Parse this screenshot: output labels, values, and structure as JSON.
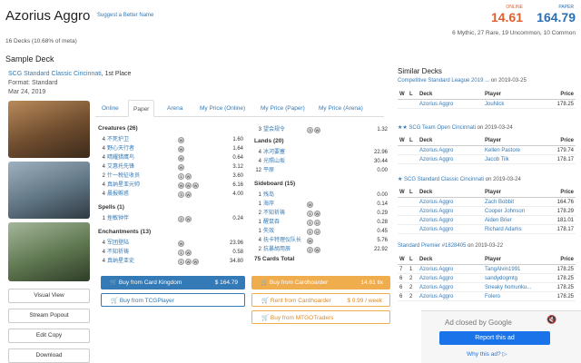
{
  "header": {
    "title": "Azorius Aggro",
    "suggest_link": "Suggest a Better Name",
    "online_label": "ONLINE",
    "online_price": "14.61",
    "paper_label": "PAPER",
    "paper_price": "164.79",
    "rarity": "6 Mythic, 27 Rare, 19 Uncommon, 10 Common",
    "decks_count": "16 Decks (10.68% of meta)"
  },
  "sample": {
    "heading": "Sample Deck",
    "event_link": "SCG Standard Classic Cincinnati",
    "event_place": ", 1st Place",
    "format": "Format: Standard",
    "date": "Mar 24, 2019"
  },
  "sidebar_buttons": [
    "Visual View",
    "Stream Popout",
    "Edit Copy",
    "Download"
  ],
  "tabs": [
    "Online",
    "Paper",
    "Arena",
    "My Price (Online)",
    "My Price (Paper)",
    "My Price (Arena)"
  ],
  "active_tab": "Paper",
  "creatures": {
    "heading": "Creatures (26)",
    "rows": [
      {
        "q": "4",
        "name": "不死护卫",
        "mana": [
          "W"
        ],
        "price": "1.60"
      },
      {
        "q": "4",
        "name": "野心天行者",
        "mana": [
          "W"
        ],
        "price": "1.64"
      },
      {
        "q": "4",
        "name": "晴耀猎鹰鸟",
        "mana": [
          "W"
        ],
        "price": "0.64"
      },
      {
        "q": "4",
        "name": "艾惠托先锋",
        "mana": [
          "W"
        ],
        "price": "3.12"
      },
      {
        "q": "2",
        "name": "什一税征收员",
        "mana": [
          "1",
          "W"
        ],
        "price": "3.60"
      },
      {
        "q": "4",
        "name": "真纳星亚元帅",
        "mana": [
          "W",
          "W",
          "W"
        ],
        "price": "6.16"
      },
      {
        "q": "4",
        "name": "晨报孵惑",
        "mana": [
          "3",
          "W"
        ],
        "price": "4.00"
      }
    ]
  },
  "spells": {
    "heading": "Spells (1)",
    "rows": [
      {
        "q": "1",
        "name": "挫敏钟伴",
        "mana": [
          "2",
          "W"
        ],
        "price": "0.24"
      }
    ]
  },
  "enchantments": {
    "heading": "Enchantments (13)",
    "rows": [
      {
        "q": "4",
        "name": "军团登陆",
        "mana": [
          "W"
        ],
        "price": "23.96"
      },
      {
        "q": "4",
        "name": "不知祈祷",
        "mana": [
          "1",
          "W"
        ],
        "price": "0.58"
      },
      {
        "q": "4",
        "name": "真纳星亚史",
        "mana": [
          "1",
          "W",
          "W"
        ],
        "price": "34.80"
      }
    ]
  },
  "col2_top": {
    "q": "3",
    "name": "望会规令",
    "mana": [
      "3",
      "W"
    ],
    "price": "1.32"
  },
  "lands": {
    "heading": "Lands (20)",
    "rows": [
      {
        "q": "4",
        "name": "冰河要塞",
        "mana": [],
        "price": "22.96"
      },
      {
        "q": "4",
        "name": "光照山坂",
        "mana": [],
        "price": "30.44"
      },
      {
        "q": "12",
        "name": "平原",
        "mana": [],
        "price": "0.00"
      }
    ]
  },
  "sideboard": {
    "heading": "Sideboard (15)",
    "rows": [
      {
        "q": "1",
        "name": "残岛",
        "mana": [],
        "price": "0.00"
      },
      {
        "q": "1",
        "name": "海岸",
        "mana": [
          "W"
        ],
        "price": "0.14"
      },
      {
        "q": "2",
        "name": "不知祈祷",
        "mana": [
          "1",
          "W"
        ],
        "price": "0.29"
      },
      {
        "q": "1",
        "name": "醒鼠吞",
        "mana": [
          "1",
          "U"
        ],
        "price": "0.28"
      },
      {
        "q": "1",
        "name": "失效",
        "mana": [
          "1",
          "U"
        ],
        "price": "0.45"
      },
      {
        "q": "4",
        "name": "抚卡特理仪队长",
        "mana": [
          "W"
        ],
        "price": "5.76"
      },
      {
        "q": "2",
        "name": "抗暴胡用辰",
        "mana": [
          "2",
          "W"
        ],
        "price": "22.92"
      }
    ]
  },
  "total": "75 Cards Total",
  "buy": {
    "card_kingdom": "Buy from Card Kingdom",
    "card_kingdom_price": "$ 164.79",
    "tcgplayer": "Buy from TCGPlayer",
    "cardhoarder": "Buy from Cardhoarder",
    "cardhoarder_price": "14.61 tix",
    "rent": "Rent from Cardhoarder",
    "rent_price": "$ 0.99 / week",
    "mtgotraders": "Buy from MTGOTraders"
  },
  "similar": {
    "heading": "Similar Decks",
    "columns": [
      "W",
      "L",
      "Deck",
      "Player",
      "Price"
    ],
    "groups": [
      {
        "event": "Competitive Standard League 2019 ...",
        "date": " on 2019-03-25",
        "rows": [
          {
            "w": "",
            "l": "",
            "deck": "Azorius Aggro",
            "player": "JouNick",
            "price": "178.25"
          }
        ]
      },
      {
        "event": "★★ SCG Team Open Cincinnati",
        "date": " on 2019-03-24",
        "rows": [
          {
            "w": "",
            "l": "",
            "deck": "Azorius Aggro",
            "player": "Kellen Pastore",
            "price": "179.74"
          },
          {
            "w": "",
            "l": "",
            "deck": "Azorius Aggro",
            "player": "Jacob Tilk",
            "price": "178.17"
          }
        ]
      },
      {
        "event": "★ SCG Standard Classic Cincinnati",
        "date": " on 2019-03-24",
        "rows": [
          {
            "w": "",
            "l": "",
            "deck": "Azorius Aggro",
            "player": "Zach Bobbit",
            "price": "164.76"
          },
          {
            "w": "",
            "l": "",
            "deck": "Azorius Aggro",
            "player": "Cooper Johnson",
            "price": "178.29"
          },
          {
            "w": "",
            "l": "",
            "deck": "Azorius Aggro",
            "player": "Aiden Brier",
            "price": "181.01"
          },
          {
            "w": "",
            "l": "",
            "deck": "Azorius Aggro",
            "player": "Richard Adams",
            "price": "178.17"
          }
        ]
      },
      {
        "event": "Standard Premier #1828405",
        "date": " on 2019-03-22",
        "rows": [
          {
            "w": "7",
            "l": "1",
            "deck": "Azorius Aggro",
            "player": "TangAlvin1991",
            "price": "178.25"
          },
          {
            "w": "6",
            "l": "2",
            "deck": "Azorius Aggro",
            "player": "sandydogmtg",
            "price": "178.25"
          },
          {
            "w": "6",
            "l": "2",
            "deck": "Azorius Aggro",
            "player": "Sneaky homunku...",
            "price": "178.25"
          },
          {
            "w": "6",
            "l": "2",
            "deck": "Azorius Aggro",
            "player": "Folero",
            "price": "178.25"
          }
        ]
      }
    ]
  },
  "ad": {
    "closed_text": "Ad closed by Google",
    "report": "Report this ad",
    "why": "Why this ad? ▷"
  },
  "colors": {
    "accent": "#337ab7",
    "online": "#e06030",
    "buy_orange": "#f0ad4e"
  }
}
